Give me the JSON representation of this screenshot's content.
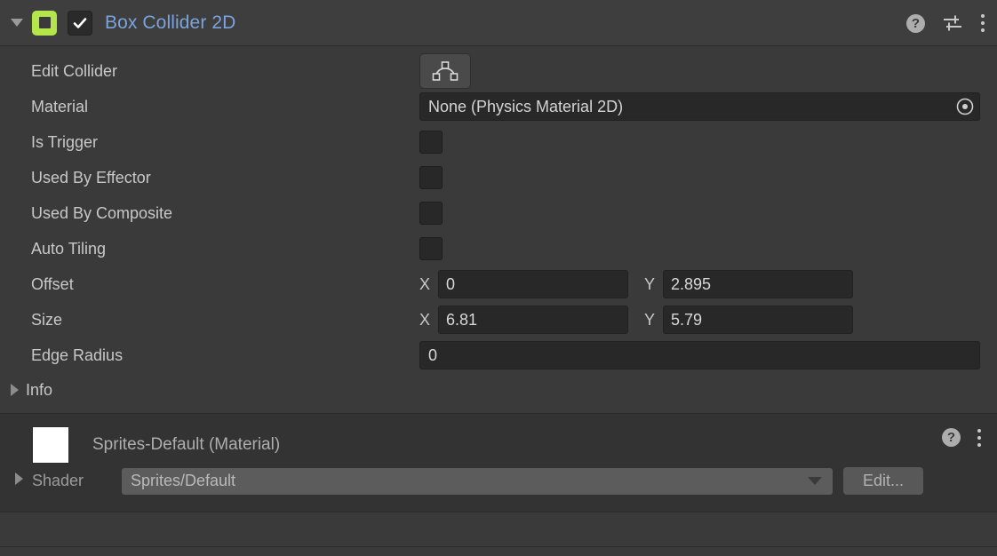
{
  "component": {
    "title": "Box Collider 2D",
    "expanded": true,
    "enabled": true,
    "icon": "box-collider-2d-icon",
    "header_icons": [
      "help-icon",
      "preset-icon",
      "more-menu-icon"
    ]
  },
  "properties": {
    "edit_collider": {
      "label": "Edit Collider",
      "button_icon": "edit-collider-polygon-icon"
    },
    "material": {
      "label": "Material",
      "value": "None (Physics Material 2D)",
      "picker_icon": "object-picker-icon"
    },
    "is_trigger": {
      "label": "Is Trigger",
      "checked": false
    },
    "used_by_effector": {
      "label": "Used By Effector",
      "checked": false
    },
    "used_by_composite": {
      "label": "Used By Composite",
      "checked": false
    },
    "auto_tiling": {
      "label": "Auto Tiling",
      "checked": false
    },
    "offset": {
      "label": "Offset",
      "x_label": "X",
      "x_value": "0",
      "y_label": "Y",
      "y_value": "2.895"
    },
    "size": {
      "label": "Size",
      "x_label": "X",
      "x_value": "6.81",
      "y_label": "Y",
      "y_value": "5.79"
    },
    "edge_radius": {
      "label": "Edge Radius",
      "value": "0"
    },
    "info": {
      "label": "Info",
      "expanded": false
    }
  },
  "material_section": {
    "name": "Sprites-Default (Material)",
    "shader_label": "Shader",
    "shader_value": "Sprites/Default",
    "edit_label": "Edit...",
    "header_icons": [
      "help-icon",
      "more-menu-icon"
    ]
  },
  "colors": {
    "background": "#3a3a3a",
    "header_background": "#3e3e3e",
    "title_text": "#7ba3dd",
    "component_icon": "#b4e54b",
    "field_background": "#282828",
    "material_section_background": "#333333"
  }
}
